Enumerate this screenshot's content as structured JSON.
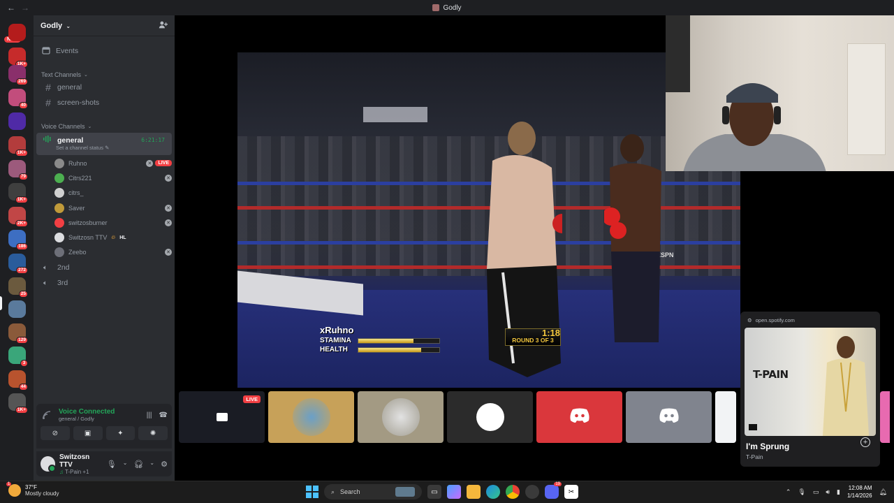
{
  "window": {
    "title": "Godly"
  },
  "rail": {
    "new_badge": "NEW",
    "servers": [
      {
        "color": "#b41c1c",
        "badge": ""
      },
      {
        "color": "#c62b2b",
        "badge": "1K+"
      },
      {
        "color": "#8a2f6b",
        "badge": "269"
      },
      {
        "color": "#c24d7c",
        "badge": "40"
      },
      {
        "color": "#4f2aa6",
        "badge": ""
      },
      {
        "color": "#b33c3c",
        "badge": "1K+"
      },
      {
        "color": "#9c5a7c",
        "badge": "79"
      },
      {
        "color": "#3f3f3f",
        "badge": "1K+"
      },
      {
        "color": "#c14646",
        "badge": "2K+"
      },
      {
        "color": "#3d6ec2",
        "badge": "186"
      },
      {
        "color": "#2a5c9b",
        "badge": "272"
      },
      {
        "color": "#6b5a3e",
        "badge": "25"
      },
      {
        "color": "#5a7a9c",
        "badge": ""
      },
      {
        "color": "#8a5a3a",
        "badge": "129"
      },
      {
        "color": "#3aa67a",
        "badge": "3"
      },
      {
        "color": "#b8532e",
        "badge": "44"
      },
      {
        "color": "#555555",
        "badge": "1K+"
      }
    ]
  },
  "sidebar": {
    "guild_name": "Godly",
    "events_label": "Events",
    "text_category": "Text Channels",
    "text_channels": [
      "general",
      "screen-shots"
    ],
    "voice_category": "Voice Channels",
    "active_voice": {
      "name": "general",
      "timer": "6:21:17",
      "status": "Set a channel status"
    },
    "voice_users": [
      {
        "name": "Ruhno",
        "live": "LIVE",
        "xbox": true,
        "color": "#8a8a8a"
      },
      {
        "name": "Citrs221",
        "live": "",
        "xbox": true,
        "color": "#4caf50"
      },
      {
        "name": "citrs_",
        "live": "",
        "xbox": false,
        "color": "#d0d0d0"
      },
      {
        "name": "Saver",
        "live": "",
        "xbox": true,
        "color": "#c09a3a"
      },
      {
        "name": "switzosburner",
        "live": "",
        "xbox": true,
        "color": "#f23f43"
      },
      {
        "name": "Switzosn TTV",
        "live": "",
        "xbox": false,
        "tag": "HL",
        "color": "#dcdde0"
      },
      {
        "name": "Zeebo",
        "live": "",
        "xbox": true,
        "color": "#6d6f78"
      }
    ],
    "other_voice": [
      "2nd",
      "3rd"
    ]
  },
  "voice_panel": {
    "title": "Voice Connected",
    "sub": "general / Godly"
  },
  "user_panel": {
    "name": "Switzosn TTV",
    "sub": "T-Pain +1"
  },
  "stream": {
    "player_name": "xRuhno",
    "stamina_label": "STAMINA",
    "health_label": "HEALTH",
    "stamina": 0.68,
    "health": 0.78,
    "clock": "1:18",
    "round": "ROUND 3 OF 3",
    "ad_text": "ESPN"
  },
  "tiles": {
    "live_tag": "LIVE"
  },
  "spotify": {
    "url": "open.spotify.com",
    "album_art_text": "T-PAIN",
    "track": "I'm Sprung",
    "artist": "T-Pain"
  },
  "taskbar": {
    "temp": "37°F",
    "condition": "Mostly cloudy",
    "search_placeholder": "Search",
    "time": "12:08 AM",
    "date": "1/14/2026",
    "discord_badge": "19"
  }
}
